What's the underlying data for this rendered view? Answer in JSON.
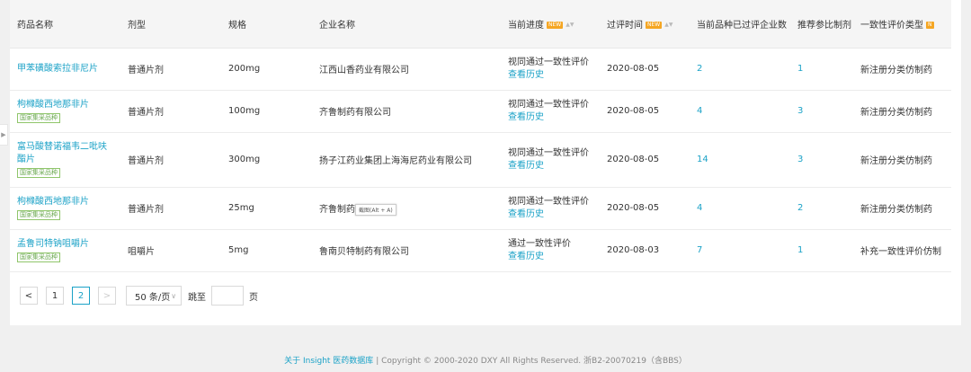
{
  "table": {
    "columns": [
      {
        "label": "药品名称"
      },
      {
        "label": "剂型"
      },
      {
        "label": "规格"
      },
      {
        "label": "企业名称"
      },
      {
        "label": "当前进度",
        "badge": "NEW",
        "sortable": true
      },
      {
        "label": "过评时间",
        "badge": "NEW",
        "sortable": true
      },
      {
        "label": "当前品种已过评企业数"
      },
      {
        "label": "推荐参比制剂"
      },
      {
        "label": "一致性评价类型",
        "badge": "N"
      }
    ],
    "rows": [
      {
        "name": "甲苯磺酸索拉非尼片",
        "tag": "",
        "form": "普通片剂",
        "spec": "200mg",
        "company": "江西山香药业有限公司",
        "progress": "视同通过一致性评价",
        "history": "查看历史",
        "date": "2020-08-05",
        "count": "2",
        "ref": "1",
        "type": "新注册分类仿制药"
      },
      {
        "name": "枸橼酸西地那非片",
        "tag": "国家集采品种",
        "form": "普通片剂",
        "spec": "100mg",
        "company": "齐鲁制药有限公司",
        "progress": "视同通过一致性评价",
        "history": "查看历史",
        "date": "2020-08-05",
        "count": "4",
        "ref": "3",
        "type": "新注册分类仿制药"
      },
      {
        "name": "富马酸替诺福韦二吡呋酯片",
        "tag": "国家集采品种",
        "form": "普通片剂",
        "spec": "300mg",
        "company": "扬子江药业集团上海海尼药业有限公司",
        "progress": "视同通过一致性评价",
        "history": "查看历史",
        "date": "2020-08-05",
        "count": "14",
        "ref": "3",
        "type": "新注册分类仿制药"
      },
      {
        "name": "枸橼酸西地那非片",
        "tag": "国家集采品种",
        "form": "普通片剂",
        "spec": "25mg",
        "company": "齐鲁制药有限公司",
        "progress": "视同通过一致性评价",
        "history": "查看历史",
        "date": "2020-08-05",
        "count": "4",
        "ref": "2",
        "type": "新注册分类仿制药"
      },
      {
        "name": "孟鲁司特钠咀嚼片",
        "tag": "国家集采品种",
        "form": "咀嚼片",
        "spec": "5mg",
        "company": "鲁南贝特制药有限公司",
        "progress": "通过一致性评价",
        "history": "查看历史",
        "date": "2020-08-03",
        "count": "7",
        "ref": "1",
        "type": "补充一致性评价仿制"
      }
    ]
  },
  "tooltip": {
    "text": "截图(Alt + A)"
  },
  "pagination": {
    "prev": "<",
    "pages": [
      "1",
      "2"
    ],
    "current": "2",
    "next": ">",
    "page_size": "50 条/页",
    "jump_label": "跳至",
    "jump_value": "",
    "page_label": "页"
  },
  "footer": {
    "link": "关于 Insight 医药数据库",
    "copyright": "| Copyright © 2000-2020 DXY All Rights Reserved. 浙B2-20070219（含BBS）"
  },
  "colors": {
    "accent": "#1ba2c7",
    "tag_green": "#6aa84f",
    "new_badge": "#f5a623"
  }
}
